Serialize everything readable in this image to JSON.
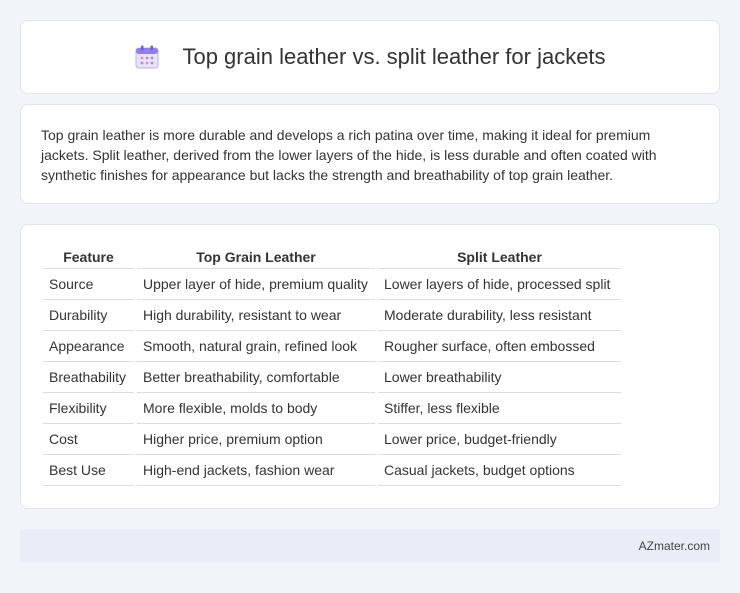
{
  "header": {
    "icon": "calendar-icon",
    "title": "Top grain leather vs. split leather for jackets"
  },
  "description": "Top grain leather is more durable and develops a rich patina over time, making it ideal for premium jackets. Split leather, derived from the lower layers of the hide, is less durable and often coated with synthetic finishes for appearance but lacks the strength and breathability of top grain leather.",
  "table": {
    "headers": [
      "Feature",
      "Top Grain Leather",
      "Split Leather"
    ],
    "rows": [
      [
        "Source",
        "Upper layer of hide, premium quality",
        "Lower layers of hide, processed split"
      ],
      [
        "Durability",
        "High durability, resistant to wear",
        "Moderate durability, less resistant"
      ],
      [
        "Appearance",
        "Smooth, natural grain, refined look",
        "Rougher surface, often embossed"
      ],
      [
        "Breathability",
        "Better breathability, comfortable",
        "Lower breathability"
      ],
      [
        "Flexibility",
        "More flexible, molds to body",
        "Stiffer, less flexible"
      ],
      [
        "Cost",
        "Higher price, premium option",
        "Lower price, budget-friendly"
      ],
      [
        "Best Use",
        "High-end jackets, fashion wear",
        "Casual jackets, budget options"
      ]
    ]
  },
  "footer": {
    "site": "AZmater.com"
  }
}
